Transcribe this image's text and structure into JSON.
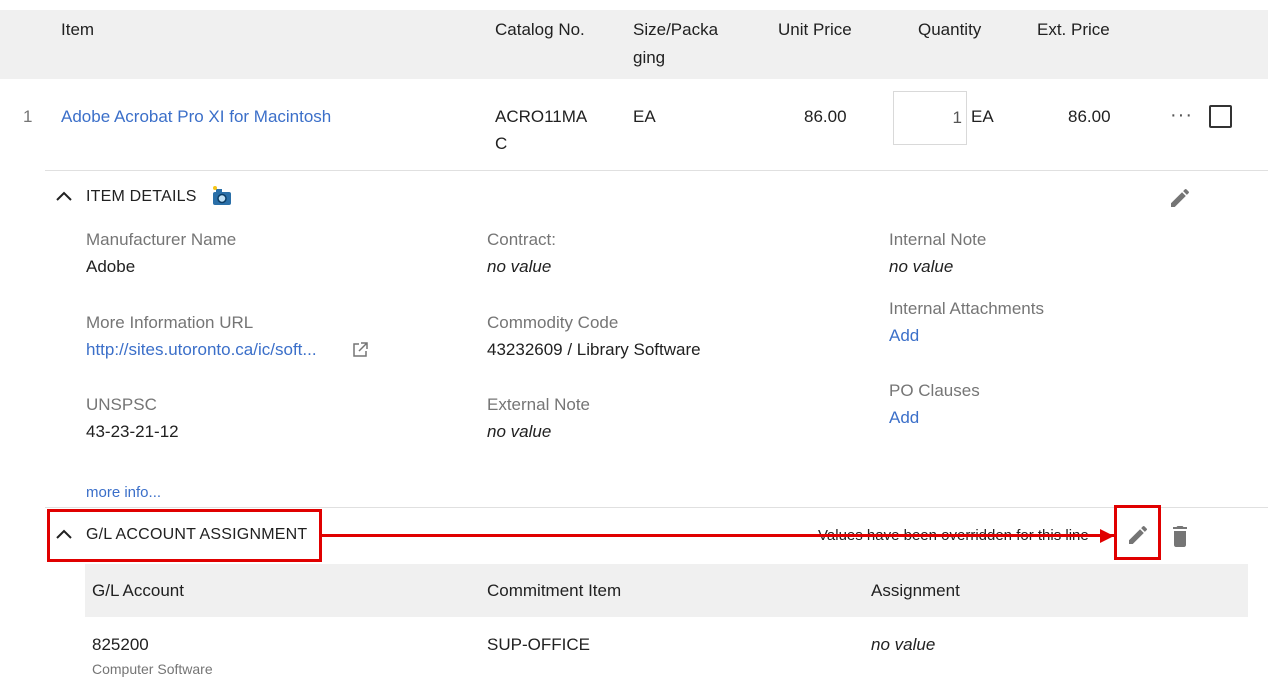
{
  "table_header": {
    "item": "Item",
    "catalog_no": "Catalog No.",
    "size_packaging_line1": "Size/Packa",
    "size_packaging_line2": "ging",
    "unit_price": "Unit Price",
    "quantity": "Quantity",
    "ext_price": "Ext. Price"
  },
  "line_item": {
    "index": "1",
    "name": "Adobe Acrobat Pro XI for Macintosh",
    "catalog_line1": "ACRO11MA",
    "catalog_line2": "C",
    "size": "EA",
    "unit_price": "86.00",
    "quantity": "1",
    "quantity_unit": "EA",
    "ext_price": "86.00",
    "more_menu": "···"
  },
  "item_details": {
    "title": "ITEM DETAILS",
    "manufacturer_label": "Manufacturer Name",
    "manufacturer_value": "Adobe",
    "url_label": "More Information URL",
    "url_value": "http://sites.utoronto.ca/ic/soft...",
    "unspsc_label": "UNSPSC",
    "unspsc_value": "43-23-21-12",
    "more_info": "more info...",
    "contract_label": "Contract:",
    "contract_value": "no value",
    "commodity_label": "Commodity Code",
    "commodity_value": "43232609 / Library Software",
    "external_note_label": "External Note",
    "external_note_value": "no value",
    "internal_note_label": "Internal Note",
    "internal_note_value": "no value",
    "internal_attach_label": "Internal Attachments",
    "internal_attach_add": "Add",
    "po_clauses_label": "PO Clauses",
    "po_clauses_add": "Add"
  },
  "gl_assignment": {
    "title": "G/L ACCOUNT ASSIGNMENT",
    "override_note": "Values have been overridden for this line",
    "col_gl": "G/L Account",
    "col_commitment": "Commitment Item",
    "col_assignment": "Assignment",
    "gl_value": "825200",
    "gl_sub": "Computer Software",
    "commitment_value": "SUP-OFFICE",
    "assignment_value": "no value"
  },
  "colors": {
    "link": "#3b6fc9",
    "highlight": "#e00000",
    "header_bg": "#f0f0f0"
  }
}
